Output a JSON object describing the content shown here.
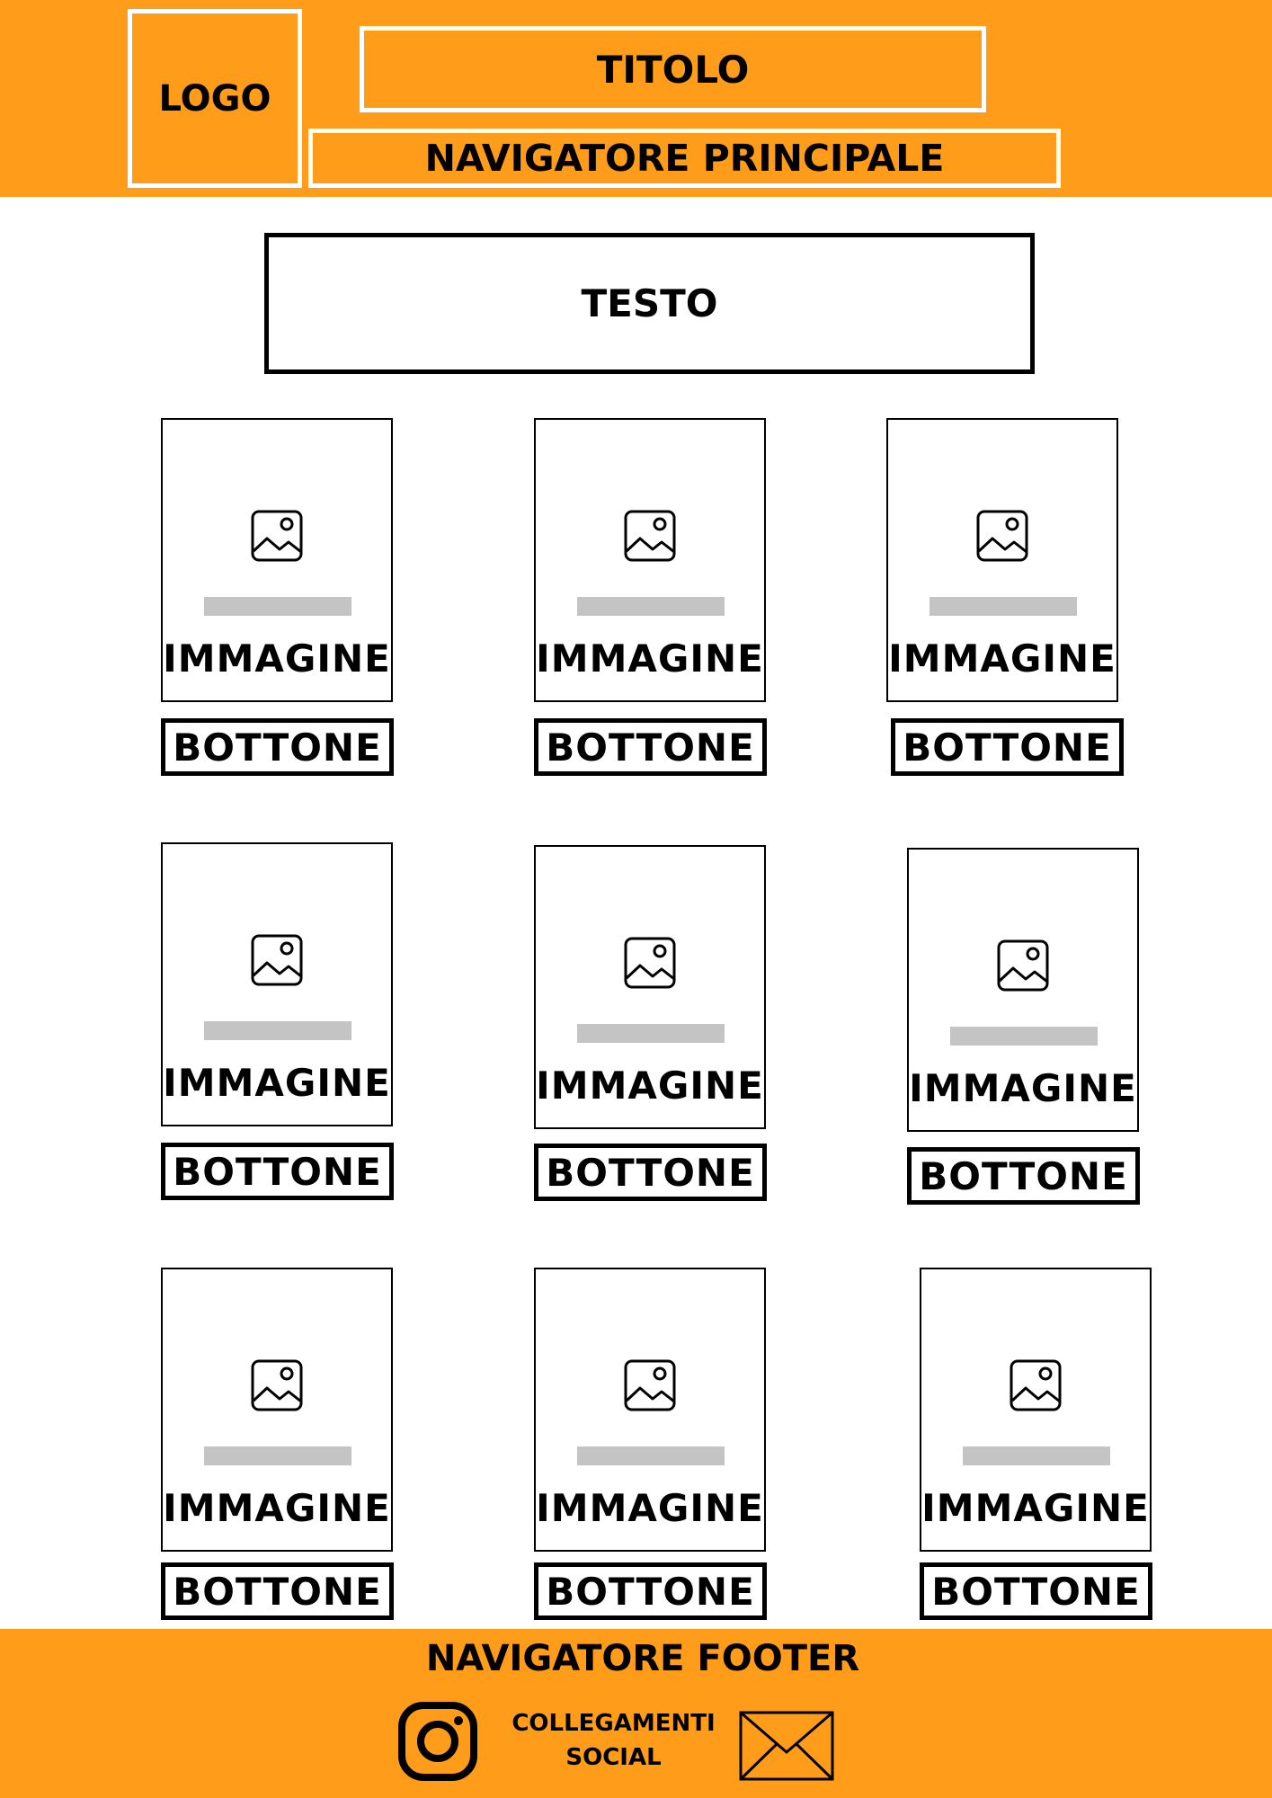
{
  "colors": {
    "accent": "#FF9C1A",
    "placeholder_bar": "#C4C4C4"
  },
  "header": {
    "logo": "LOGO",
    "title": "TITOLO",
    "nav": "NAVIGATORE PRINCIPALE"
  },
  "main": {
    "text": "TESTO",
    "cards": [
      {
        "caption": "IMMAGINE",
        "button": "BOTTONE",
        "icon": "image-icon"
      },
      {
        "caption": "IMMAGINE",
        "button": "BOTTONE",
        "icon": "image-icon"
      },
      {
        "caption": "IMMAGINE",
        "button": "BOTTONE",
        "icon": "image-icon"
      },
      {
        "caption": "IMMAGINE",
        "button": "BOTTONE",
        "icon": "image-icon"
      },
      {
        "caption": "IMMAGINE",
        "button": "BOTTONE",
        "icon": "image-icon"
      },
      {
        "caption": "IMMAGINE",
        "button": "BOTTONE",
        "icon": "image-icon"
      },
      {
        "caption": "IMMAGINE",
        "button": "BOTTONE",
        "icon": "image-icon"
      },
      {
        "caption": "IMMAGINE",
        "button": "BOTTONE",
        "icon": "image-icon"
      },
      {
        "caption": "IMMAGINE",
        "button": "BOTTONE",
        "icon": "image-icon"
      }
    ]
  },
  "footer": {
    "title": "NAVIGATORE FOOTER",
    "social_line1": "COLLEGAMENTI",
    "social_line2": "SOCIAL",
    "icons": [
      "instagram-icon",
      "mail-icon"
    ]
  }
}
